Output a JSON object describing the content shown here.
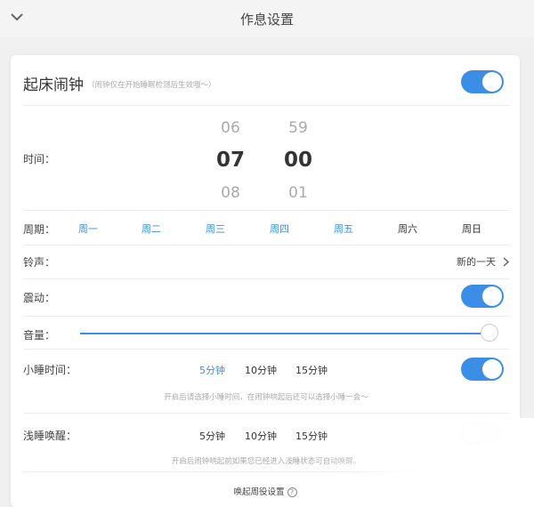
{
  "header": {
    "title": "作息设置",
    "back_icon": "chevron-down-icon"
  },
  "alarm": {
    "title": "起床闹钟",
    "subtitle": "（闹钟仅在开始睡眠检测后生效哦～）",
    "enabled": true
  },
  "time": {
    "label": "时间：",
    "hour": {
      "prev": "06",
      "current": "07",
      "next": "08"
    },
    "minute": {
      "prev": "59",
      "current": "00",
      "next": "01"
    }
  },
  "week": {
    "label": "周期：",
    "days": [
      {
        "label": "周一",
        "selected": true
      },
      {
        "label": "周二",
        "selected": true
      },
      {
        "label": "周三",
        "selected": true
      },
      {
        "label": "周四",
        "selected": true
      },
      {
        "label": "周五",
        "selected": true
      },
      {
        "label": "周六",
        "selected": false
      },
      {
        "label": "周日",
        "selected": false
      }
    ]
  },
  "ringtone": {
    "label": "铃声：",
    "value": "新的一天",
    "icon": "chevron-right-icon"
  },
  "vibrate": {
    "label": "震动：",
    "enabled": true
  },
  "volume": {
    "label": "音量：",
    "level": 1.0
  },
  "snooze": {
    "label": "小睡时间：",
    "options": [
      "5分钟",
      "10分钟",
      "15分钟"
    ],
    "selected": "5分钟",
    "enabled": true,
    "hint": "开启后请选择小睡时间，在闹钟响起后还可以选择小睡一会～"
  },
  "light_wake": {
    "label": "浅睡唤醒：",
    "options": [
      "5分钟",
      "10分钟",
      "15分钟"
    ],
    "enabled": false,
    "hint": "开启后闹钟响起前如果您已经进入浅睡状态可自动唤醒。"
  },
  "footer": {
    "link": "唤起周役设置"
  },
  "colors": {
    "accent": "#3a8ee6",
    "toggle_off": "#e7e7e7",
    "background": "#f0f0f0"
  }
}
